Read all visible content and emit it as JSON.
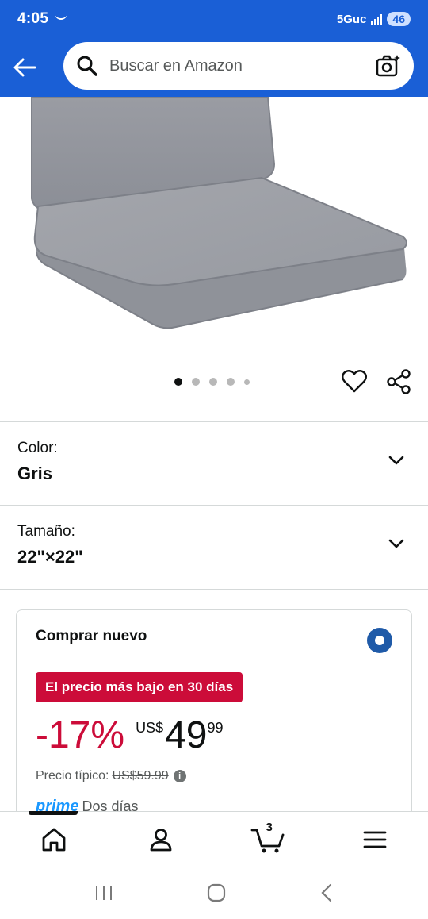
{
  "status_bar": {
    "time": "4:05",
    "network": "5Guc",
    "battery": "46"
  },
  "header": {
    "search_placeholder": "Buscar en Amazon"
  },
  "carousel": {
    "image_count": 5,
    "active_index": 0
  },
  "variations": [
    {
      "label": "Color:",
      "value": "Gris"
    },
    {
      "label": "Tamaño:",
      "value": "22\"×22\""
    }
  ],
  "buy_box": {
    "title": "Comprar nuevo",
    "deal_badge": "El precio más bajo en 30 días",
    "discount": "-17%",
    "currency": "US$",
    "price_whole": "49",
    "price_fraction": "99",
    "typical_label": "Precio típico:",
    "typical_price": "US$59.99",
    "prime_label": "prime",
    "delivery_text": "Dos días"
  },
  "bottom_nav": {
    "cart_count": "3",
    "active_tab": "home"
  },
  "colors": {
    "header_blue": "#1a5fd6",
    "deal_red": "#cc0c39",
    "radio_blue": "#1f5aa8",
    "prime_blue": "#1a98ff"
  }
}
